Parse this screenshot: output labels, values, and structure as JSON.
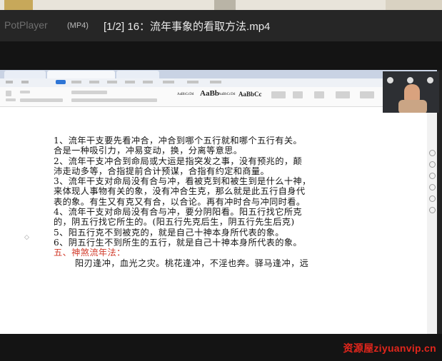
{
  "player": {
    "brand": "PotPlayer",
    "format": "(MP4)",
    "title": "[1/2] 16：流年事象的看取方法.mp4"
  },
  "document": {
    "lines": [
      "1、流年干支要先看冲合，冲合到哪个五行就和哪个五行有关。",
      "合是一种吸引力，冲易变动，换，分离等意思。",
      "2、流年干支冲合到命局或大运是指突发之事，没有预兆的，颠",
      "沛走动多等，合指提前合计预谋，合指有约定和商量。",
      "3、流年干支对命局没有合与冲，看被克到和被生到是什么十神，",
      "来体现人事物有关的象，没有冲合生克，那么就是此五行自身代",
      "表的象。有生又有克又有合，以合论。再有冲时合与冲同时看。",
      "4、流年干支对命局没有合与冲，要分阴阳看。阳五行找它所克",
      "的，阴五行找它所生的。(阳五行先克后生，阴五行先生后克)",
      "5、阳五行克不到被克的，就是自己十神本身所代表的象。",
      "6、阴五行生不到所生的五行，就是自己十神本身所代表的象。"
    ],
    "section_heading": "五、神煞流年法：",
    "last_line": "阳刃逢冲，血光之灾。桃花逢冲，不淫也奔。驿马逢冲，远"
  },
  "ribbon": {
    "styles": [
      "AaBbCcDd",
      "AaBb",
      "AaBbCcDd",
      "AaBbCc"
    ]
  },
  "watermark": "资源屋ziyuanvip.cn"
}
